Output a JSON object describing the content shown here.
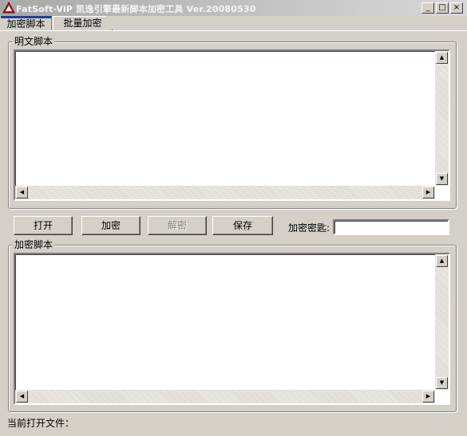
{
  "window": {
    "title": "FatSoft-ViP 凯逸引擎最新脚本加密工具 Ver.20080530",
    "minimize_glyph": "_",
    "maximize_glyph": "□",
    "close_glyph": "×"
  },
  "tabs": [
    {
      "label": "加密脚本",
      "active": true
    },
    {
      "label": "批量加密",
      "active": false
    }
  ],
  "plain_group": {
    "title": "明文脚本",
    "content": ""
  },
  "buttons": {
    "open": "打开",
    "encrypt": "加密",
    "decrypt": "解密",
    "save": "保存"
  },
  "key": {
    "label": "加密密匙:",
    "value": ""
  },
  "encrypted_group": {
    "title": "加密脚本",
    "content": ""
  },
  "status": {
    "current_file_label": "当前打开文件："
  },
  "scroll_glyphs": {
    "up": "▲",
    "down": "▼",
    "left": "◀",
    "right": "▶"
  },
  "colors": {
    "tab_accent": "#1f3f9f",
    "face": "#d4d0c8",
    "app_icon": "#c0201c"
  }
}
